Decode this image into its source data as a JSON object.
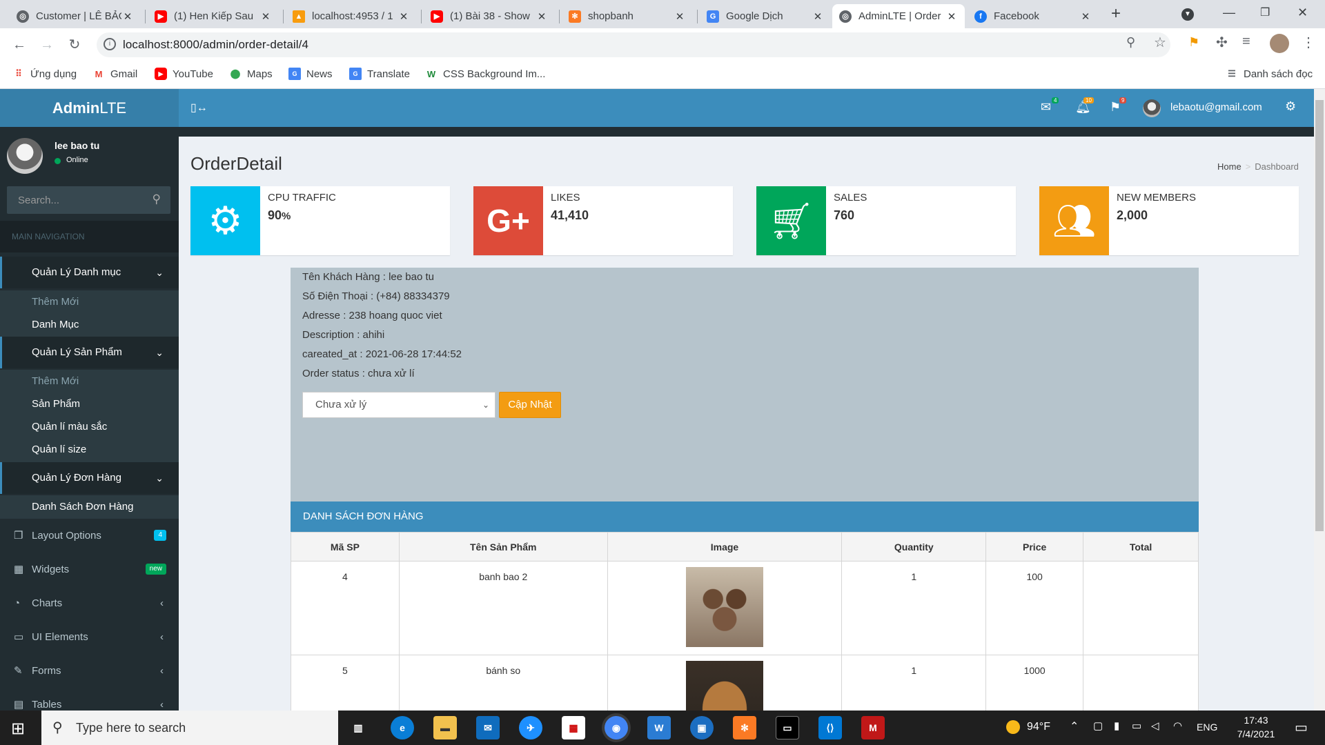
{
  "browser": {
    "tabs": [
      {
        "title": "Customer | LÊ BẢO",
        "icon": "page-icon"
      },
      {
        "title": "(1) Hen Kiếp Sau",
        "icon": "youtube-icon"
      },
      {
        "title": "localhost:4953 / 1",
        "icon": "pma-icon"
      },
      {
        "title": "(1) Bài 38 - Show",
        "icon": "youtube-icon"
      },
      {
        "title": "shopbanh",
        "icon": "xampp-icon"
      },
      {
        "title": "Google Dịch",
        "icon": "translate-icon"
      },
      {
        "title": "AdminLTE | Order",
        "icon": "page-icon"
      },
      {
        "title": "Facebook",
        "icon": "facebook-icon"
      }
    ],
    "url": "localhost:8000/admin/order-detail/4",
    "bookmarks": [
      {
        "label": "Ứng dụng"
      },
      {
        "label": "Gmail"
      },
      {
        "label": "YouTube"
      },
      {
        "label": "Maps"
      },
      {
        "label": "News"
      },
      {
        "label": "Translate"
      },
      {
        "label": "CSS Background Im..."
      }
    ],
    "reading_list": "Danh sách đọc"
  },
  "header": {
    "logo_bold": "Admin",
    "logo_light": "LTE",
    "messages_count": "4",
    "notifications_count": "10",
    "tasks_count": "9",
    "user_email": "lebaotu@gmail.com"
  },
  "sidebar": {
    "user_name": "lee bao tu",
    "user_status": "Online",
    "search_placeholder": "Search...",
    "nav_header": "MAIN NAVIGATION",
    "group_category": "Quản Lý Danh mục",
    "category_items": [
      "Thêm Mới",
      "Danh Mục"
    ],
    "group_product": "Quản Lý Sản Phẩm",
    "product_items": [
      "Thêm Mới",
      "Sản Phẩm",
      "Quản lí màu sắc",
      "Quản lí size"
    ],
    "group_order": "Quản Lý Đơn Hàng",
    "order_items": [
      "Danh Sách Đơn Hàng"
    ],
    "links": [
      {
        "label": "Layout Options",
        "badge": "4",
        "badge_color": "#00c0ef"
      },
      {
        "label": "Widgets",
        "badge": "new",
        "badge_color": "#00a65a"
      },
      {
        "label": "Charts"
      },
      {
        "label": "UI Elements"
      },
      {
        "label": "Forms"
      },
      {
        "label": "Tables"
      }
    ]
  },
  "page": {
    "title": "OrderDetail",
    "breadcrumb_home": "Home",
    "breadcrumb_current": "Dashboard"
  },
  "info_boxes": [
    {
      "label": "CPU TRAFFIC",
      "value": "90",
      "unit": "%",
      "color": "#00c0ef",
      "icon": "gears-icon"
    },
    {
      "label": "LIKES",
      "value": "41,410",
      "color": "#dd4b39",
      "icon": "google-plus-icon"
    },
    {
      "label": "SALES",
      "value": "760",
      "color": "#00a65a",
      "icon": "shopping-cart-icon"
    },
    {
      "label": "NEW MEMBERS",
      "value": "2,000",
      "color": "#f39c12",
      "icon": "users-icon"
    }
  ],
  "order": {
    "customer": "Tên Khách Hàng : lee bao tu",
    "phone": "Số Điện Thoại : (+84) 88334379",
    "address": "Adresse : 238 hoang quoc viet",
    "description": "Description : ahihi",
    "created": "careated_at : 2021-06-28 17:44:52",
    "status": "Order status : chưa xử lí",
    "status_select": "Chưa xử lý",
    "update_button": "Cập Nhật"
  },
  "order_table": {
    "title": "DANH SÁCH ĐƠN HÀNG",
    "columns": [
      "Mã SP",
      "Tên Sản Phẩm",
      "Image",
      "Quantity",
      "Price",
      "Total"
    ],
    "rows": [
      {
        "id": "4",
        "name": "banh bao 2",
        "quantity": "1",
        "price": "100",
        "total": ""
      },
      {
        "id": "5",
        "name": "bánh so",
        "quantity": "1",
        "price": "1000",
        "total": ""
      }
    ]
  },
  "taskbar": {
    "search_placeholder": "Type here to search",
    "weather": "94°F",
    "language": "ENG",
    "time": "17:43",
    "date": "7/4/2021"
  }
}
